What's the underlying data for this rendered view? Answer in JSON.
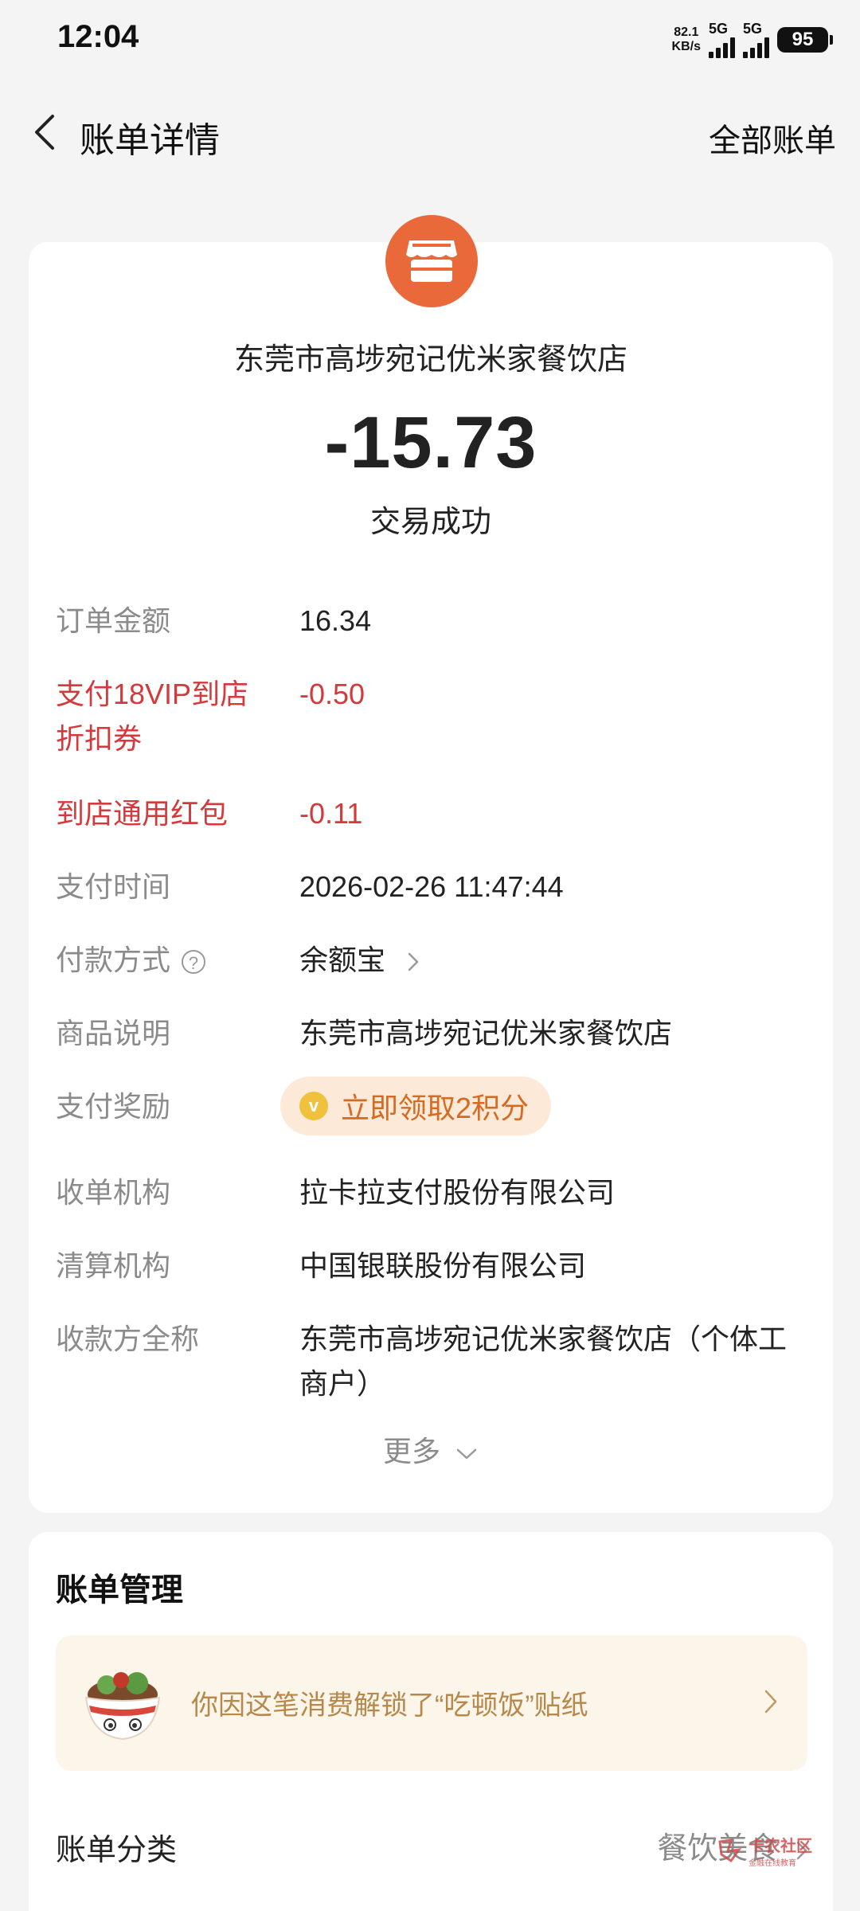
{
  "status_bar": {
    "time": "12:04",
    "net_speed_value": "82.1",
    "net_speed_unit": "KB/s",
    "signal1_label": "5G",
    "signal2_label": "5G",
    "battery": "95"
  },
  "nav": {
    "title": "账单详情",
    "action": "全部账单"
  },
  "transaction": {
    "merchant_name": "东莞市高埗宛记优米家餐饮店",
    "amount": "-15.73",
    "status": "交易成功"
  },
  "details": {
    "order_amount": {
      "label": "订单金额",
      "value": "16.34"
    },
    "coupon": {
      "label_line1": "支付18VIP到店",
      "label_line2": "折扣券",
      "value": "-0.50"
    },
    "red_packet": {
      "label": "到店通用红包",
      "value": "-0.11"
    },
    "pay_time": {
      "label": "支付时间",
      "value": "2026-02-26 11:47:44"
    },
    "pay_method": {
      "label": "付款方式",
      "value": "余额宝"
    },
    "product_desc": {
      "label": "商品说明",
      "value": "东莞市高埗宛记优米家餐饮店"
    },
    "reward": {
      "label": "支付奖励",
      "value": "立即领取2积分"
    },
    "acquirer": {
      "label": "收单机构",
      "value": "拉卡拉支付股份有限公司"
    },
    "clearing": {
      "label": "清算机构",
      "value": "中国银联股份有限公司"
    },
    "payee": {
      "label": "收款方全称",
      "value_line1": "东莞市高埗宛记优米家餐饮店（个体工",
      "value_line2": "商户）"
    },
    "more": "更多"
  },
  "bill_management": {
    "title": "账单管理",
    "sticker_text": "你因这笔消费解锁了“吃顿饭”贴纸",
    "category_label": "账单分类",
    "category_value": "餐饮美食"
  },
  "watermark": {
    "line1": "卡农社区",
    "line2": "金融在线教育"
  },
  "colors": {
    "accent_orange": "#e9693a",
    "discount_red": "#d4393b",
    "reward_text": "#d56a22",
    "sticker_text": "#b7884a"
  }
}
